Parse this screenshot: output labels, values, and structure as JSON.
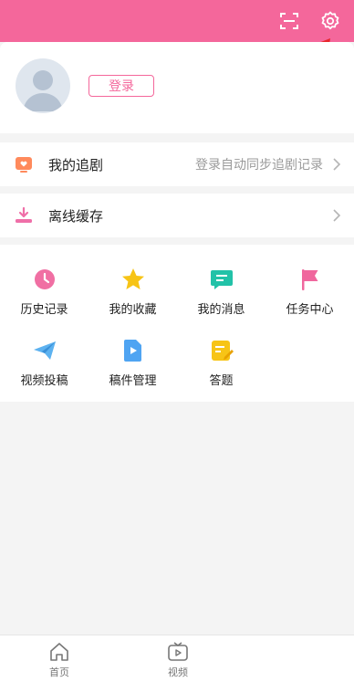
{
  "colors": {
    "brand": "#f4679b",
    "background": "#f4f4f4"
  },
  "header": {
    "icons": [
      "scan-icon",
      "settings-icon"
    ]
  },
  "profile": {
    "login_label": "登录"
  },
  "menu": {
    "following": {
      "label": "我的追剧",
      "hint": "登录自动同步追剧记录"
    },
    "offline": {
      "label": "离线缓存"
    }
  },
  "grid": {
    "items": [
      {
        "label": "历史记录",
        "icon": "clock-icon"
      },
      {
        "label": "我的收藏",
        "icon": "star-icon"
      },
      {
        "label": "我的消息",
        "icon": "message-icon"
      },
      {
        "label": "任务中心",
        "icon": "flag-icon"
      },
      {
        "label": "视频投稿",
        "icon": "paper-plane-icon"
      },
      {
        "label": "稿件管理",
        "icon": "video-file-icon"
      },
      {
        "label": "答题",
        "icon": "quiz-icon"
      }
    ]
  },
  "tabbar": {
    "tabs": [
      {
        "label": "首页",
        "icon": "home-icon"
      },
      {
        "label": "视频",
        "icon": "tv-play-icon"
      }
    ]
  }
}
